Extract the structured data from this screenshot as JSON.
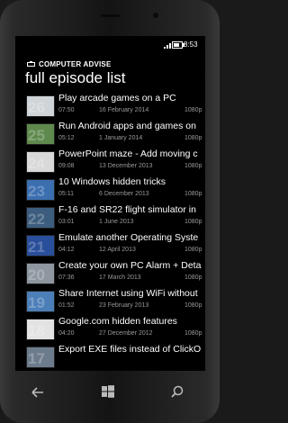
{
  "status": {
    "time": "8:53"
  },
  "app": {
    "name": "COMPUTER ADVISE",
    "page_title": "full episode list"
  },
  "episodes": [
    {
      "num": "26",
      "title": "Play arcade games on a PC",
      "duration": "07:50",
      "date": "16 February 2014",
      "res": "1080p",
      "color": "#cfd4d8"
    },
    {
      "num": "25",
      "title": "Run Android apps and games on",
      "duration": "05:12",
      "date": "1 January 2014",
      "res": "1080p",
      "color": "#5f8a4e"
    },
    {
      "num": "24",
      "title": "PowerPoint maze - Add moving c",
      "duration": "09:08",
      "date": "13 December 2013",
      "res": "1080p",
      "color": "#d9d9d9"
    },
    {
      "num": "23",
      "title": "10 Windows hidden tricks",
      "duration": "05:11",
      "date": "6 December 2013",
      "res": "1080p",
      "color": "#3c6fb0"
    },
    {
      "num": "22",
      "title": "F-16 and SR22 flight simulator in",
      "duration": "03:01",
      "date": "1 June 2013",
      "res": "1080p",
      "color": "#3d5d7e"
    },
    {
      "num": "21",
      "title": "Emulate another Operating Syste",
      "duration": "04:12",
      "date": "12 April 2013",
      "res": "1080p",
      "color": "#2a4f9a"
    },
    {
      "num": "20",
      "title": "Create your own PC Alarm + Deta",
      "duration": "07:36",
      "date": "17 March 2013",
      "res": "1080p",
      "color": "#8e96a0"
    },
    {
      "num": "19",
      "title": "Share Internet using WiFi without",
      "duration": "01:52",
      "date": "23 February 2013",
      "res": "1080p",
      "color": "#4c7fb8"
    },
    {
      "num": "18",
      "title": "Google.com hidden features",
      "duration": "04:20",
      "date": "27 December 2012",
      "res": "1080p",
      "color": "#e3e3e3"
    },
    {
      "num": "17",
      "title": "Export EXE files instead of ClickO",
      "duration": "",
      "date": "",
      "res": "",
      "color": "#6d7c8c"
    }
  ],
  "icons": [
    "app-icon",
    "signal-icon",
    "battery-icon",
    "back-icon",
    "windows-start-icon",
    "search-icon"
  ]
}
